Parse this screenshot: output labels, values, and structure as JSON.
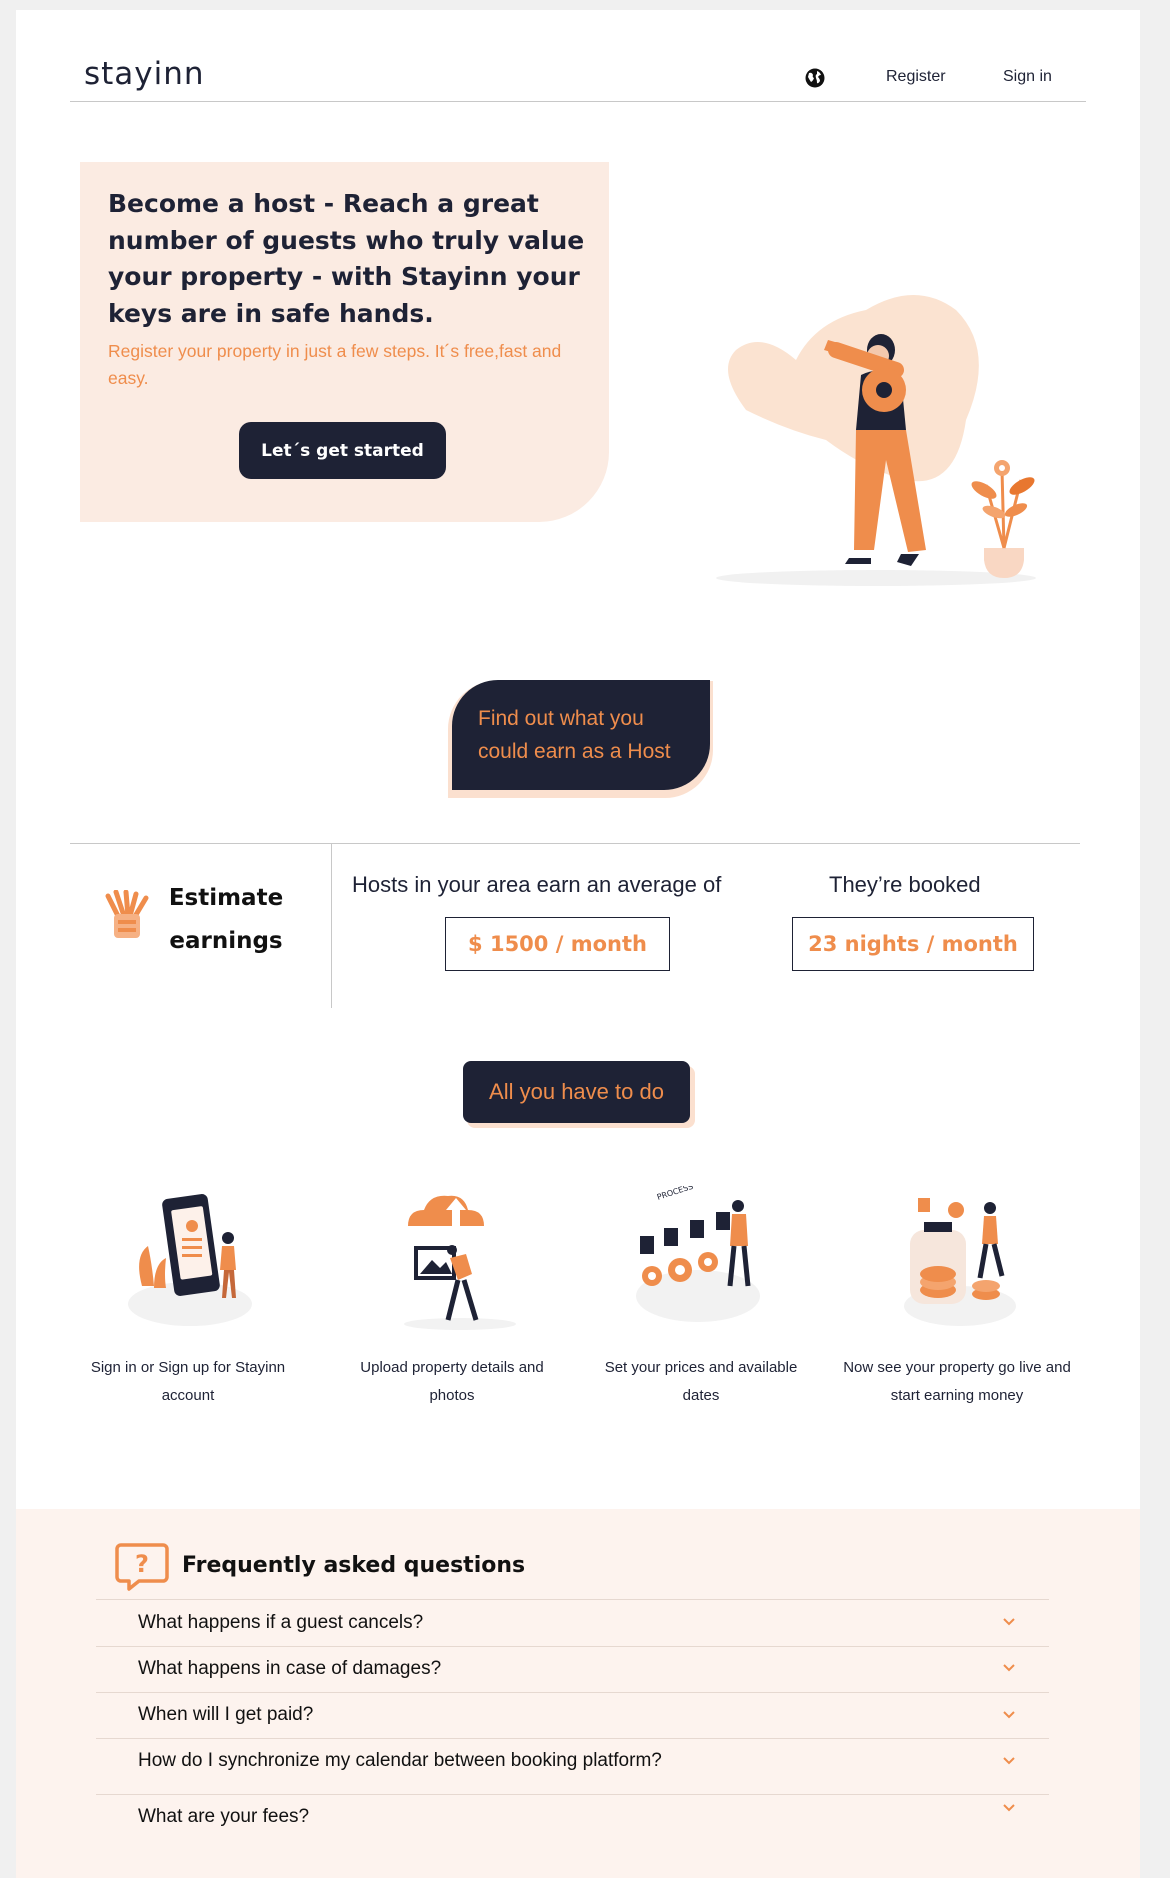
{
  "header": {
    "logo": "stayinn",
    "register_label": "Register",
    "signin_label": "Sign in",
    "globe_icon": "globe-icon"
  },
  "hero": {
    "title": "Become a host - Reach a great number of guests who truly value your property - with Stayinn your keys are in safe hands.",
    "subtitle": "Register your property in just a few steps. It´s free,fast and easy.",
    "cta_label": "Let´s get started",
    "illustration": "woman-holding-key-illustration"
  },
  "earn_bubble": {
    "line1": "Find out what you",
    "line2": "could earn as a Host"
  },
  "estimate": {
    "icon": "money-icon",
    "title": "Estimate earnings",
    "avg_label": "Hosts in your area earn an average of",
    "avg_value": "$ 1500 / month",
    "booked_label": "They’re booked",
    "booked_value": "23 nights / month"
  },
  "todo": {
    "label": "All you have to do"
  },
  "steps": [
    {
      "line1": "Sign in or  Sign up for Stayinn",
      "line2": "account",
      "illustration": "sign-up-illustration"
    },
    {
      "line1": "Upload property  details and",
      "line2": "photos",
      "illustration": "upload-illustration"
    },
    {
      "line1": "Set your prices and available",
      "line2": "dates",
      "illustration": "process-illustration"
    },
    {
      "line1": "Now see your property go live and",
      "line2": "start earning money",
      "illustration": "earning-money-illustration"
    }
  ],
  "faq": {
    "icon": "question-bubble-icon",
    "title": "Frequently asked questions",
    "items": [
      "What happens if a guest cancels?",
      "What happens in case of damages?",
      "When will I get paid?",
      "How do I synchronize my calendar between booking platform?",
      "What are your fees?"
    ]
  },
  "colors": {
    "navy": "#1e2235",
    "orange": "#ef8d4c",
    "peach": "#fbebe2",
    "faq_bg": "#fdf3ee"
  }
}
